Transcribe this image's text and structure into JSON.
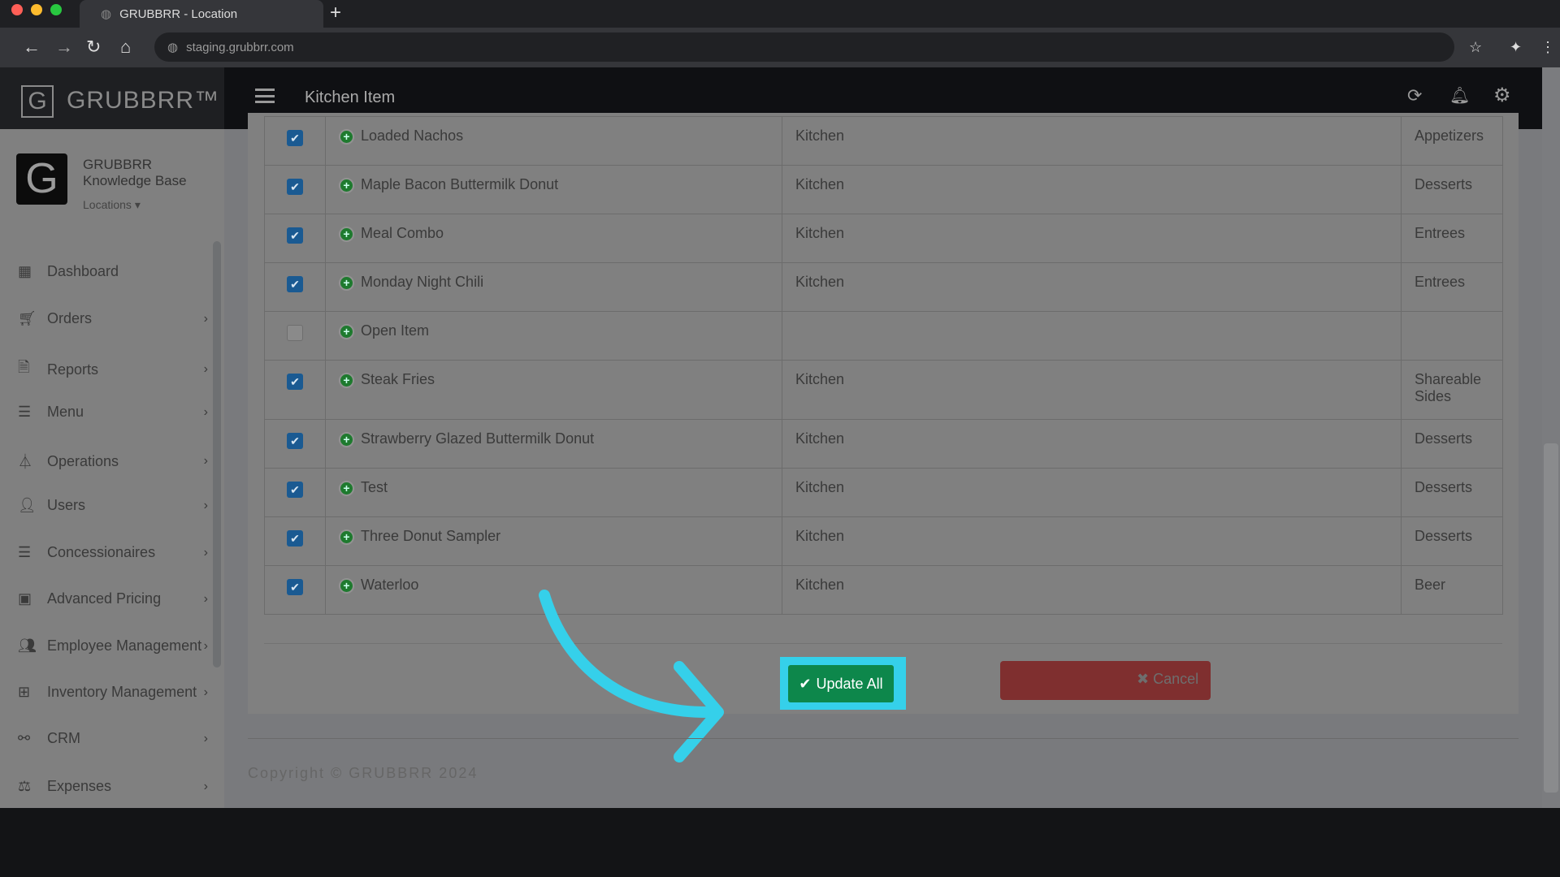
{
  "browser": {
    "tab_title": "GRUBBRR - Location",
    "url": "staging.grubbrr.com"
  },
  "brand": {
    "logo_text": "GRUBBRR™"
  },
  "header": {
    "title": "Kitchen Item"
  },
  "profile": {
    "name": "GRUBBRR Knowledge Base",
    "locations_label": "Locations"
  },
  "sidebar": {
    "items": [
      {
        "label": "Dashboard",
        "icon": "dashboard-icon",
        "chevron": false
      },
      {
        "label": "Orders",
        "icon": "cart-icon",
        "chevron": true
      },
      {
        "label": "Reports",
        "icon": "file-icon",
        "chevron": true
      },
      {
        "label": "Menu",
        "icon": "list-icon",
        "chevron": true
      },
      {
        "label": "Operations",
        "icon": "flask-icon",
        "chevron": true
      },
      {
        "label": "Users",
        "icon": "user-plus-icon",
        "chevron": true
      },
      {
        "label": "Concessionaires",
        "icon": "list-icon",
        "chevron": true
      },
      {
        "label": "Advanced Pricing",
        "icon": "money-icon",
        "chevron": true
      },
      {
        "label": "Employee Management",
        "icon": "users-icon",
        "chevron": true
      },
      {
        "label": "Inventory Management",
        "icon": "sitemap-icon",
        "chevron": true
      },
      {
        "label": "CRM",
        "icon": "link-icon",
        "chevron": true
      },
      {
        "label": "Expenses",
        "icon": "balance-icon",
        "chevron": true
      }
    ]
  },
  "table": {
    "rows": [
      {
        "checked": true,
        "name": "Loaded Nachos",
        "station": "Kitchen",
        "category": "Appetizers"
      },
      {
        "checked": true,
        "name": "Maple Bacon Buttermilk Donut",
        "station": "Kitchen",
        "category": "Desserts"
      },
      {
        "checked": true,
        "name": "Meal Combo",
        "station": "Kitchen",
        "category": "Entrees"
      },
      {
        "checked": true,
        "name": "Monday Night Chili",
        "station": "Kitchen",
        "category": "Entrees"
      },
      {
        "checked": false,
        "name": "Open Item",
        "station": "",
        "category": ""
      },
      {
        "checked": true,
        "name": "Steak Fries",
        "station": "Kitchen",
        "category": "Shareable Sides"
      },
      {
        "checked": true,
        "name": "Strawberry Glazed Buttermilk Donut",
        "station": "Kitchen",
        "category": "Desserts"
      },
      {
        "checked": true,
        "name": "Test",
        "station": "Kitchen",
        "category": "Desserts"
      },
      {
        "checked": true,
        "name": "Three Donut Sampler",
        "station": "Kitchen",
        "category": "Desserts"
      },
      {
        "checked": true,
        "name": "Waterloo",
        "station": "Kitchen",
        "category": "Beer"
      }
    ]
  },
  "actions": {
    "update_all": "Update All",
    "cancel": "Cancel"
  },
  "footer": {
    "copyright": "Copyright © GRUBBRR 2024"
  },
  "colors": {
    "highlight": "#35d0ea",
    "update": "#0d874b",
    "cancel": "#7f2f2f",
    "checkbox": "#1a5a92"
  }
}
